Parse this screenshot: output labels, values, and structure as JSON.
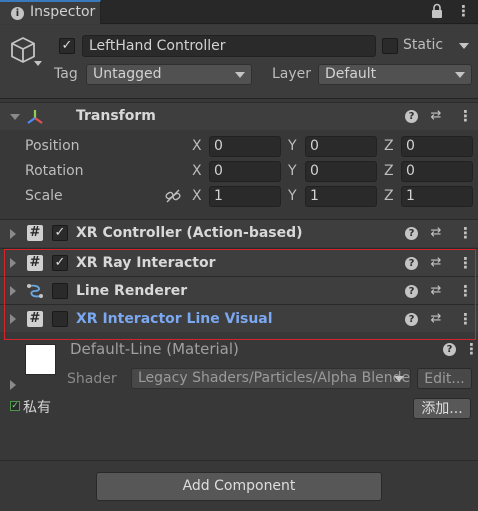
{
  "tab": {
    "title": "Inspector"
  },
  "header": {
    "object_active": "✓",
    "object_name": "LeftHand Controller",
    "static_label": "Static",
    "tag_label": "Tag",
    "tag_value": "Untagged",
    "layer_label": "Layer",
    "layer_value": "Default"
  },
  "transform": {
    "title": "Transform",
    "rows": [
      {
        "label": "Position",
        "x": "0",
        "y": "0",
        "z": "0"
      },
      {
        "label": "Rotation",
        "x": "0",
        "y": "0",
        "z": "0"
      },
      {
        "label": "Scale",
        "x": "1",
        "y": "1",
        "z": "1"
      }
    ],
    "axis_x": "X",
    "axis_y": "Y",
    "axis_z": "Z"
  },
  "components": [
    {
      "title": "XR Controller (Action-based)",
      "enabled": "✓"
    },
    {
      "title": "XR Ray Interactor",
      "enabled": "✓"
    },
    {
      "title": "Line Renderer",
      "enabled": ""
    },
    {
      "title": "XR Interactor Line Visual",
      "enabled": ""
    }
  ],
  "material": {
    "title": "Default-Line (Material)",
    "shader_label": "Shader",
    "shader_value": "Legacy Shaders/Particles/Alpha Blended",
    "edit_label": "Edit..."
  },
  "private_label": "私有",
  "add_label": "添加...",
  "add_component_label": "Add Component",
  "colors": {
    "background": "#383838",
    "accent_blue": "#3a79bb",
    "highlight_red": "#d2262b",
    "link_blue": "#7ba8f0"
  }
}
